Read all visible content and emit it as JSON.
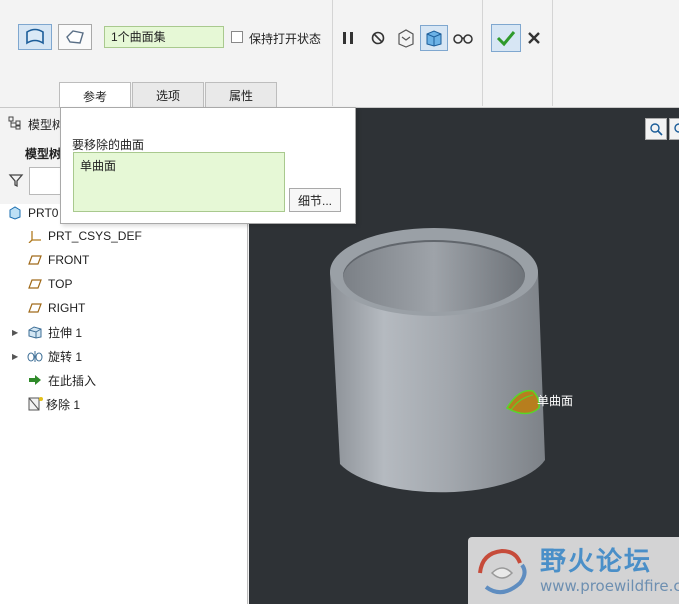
{
  "ribbon": {
    "collector_value": "1个曲面集",
    "keep_open_label": "保持打开状态",
    "tabs": [
      {
        "label": "参考"
      },
      {
        "label": "选项"
      },
      {
        "label": "属性"
      }
    ]
  },
  "popup": {
    "title": "要移除的曲面",
    "items": [
      "单曲面"
    ],
    "detail_button": "细节..."
  },
  "tree": {
    "header_label": "模型树",
    "sub_label": "模型树",
    "root": "PRT0",
    "items": [
      {
        "label": "PRT_CSYS_DEF",
        "icon": "csys-icon"
      },
      {
        "label": "FRONT",
        "icon": "datum-plane-icon"
      },
      {
        "label": "TOP",
        "icon": "datum-plane-icon"
      },
      {
        "label": "RIGHT",
        "icon": "datum-plane-icon"
      },
      {
        "label": "拉伸 1",
        "icon": "extrude-icon"
      },
      {
        "label": "旋转 1",
        "icon": "revolve-icon"
      },
      {
        "label": "在此插入",
        "icon": "insert-arrow-icon"
      },
      {
        "label": "移除 1",
        "icon": "remove-feature-icon"
      }
    ]
  },
  "viewport": {
    "surface_label": "单曲面",
    "background_color": "#2e3236"
  },
  "watermark": {
    "title": "野火论坛",
    "url": "www.proewildfire.cn"
  },
  "colors": {
    "accent_green": "#3aa335",
    "collector_bg": "#e6f8d6"
  }
}
